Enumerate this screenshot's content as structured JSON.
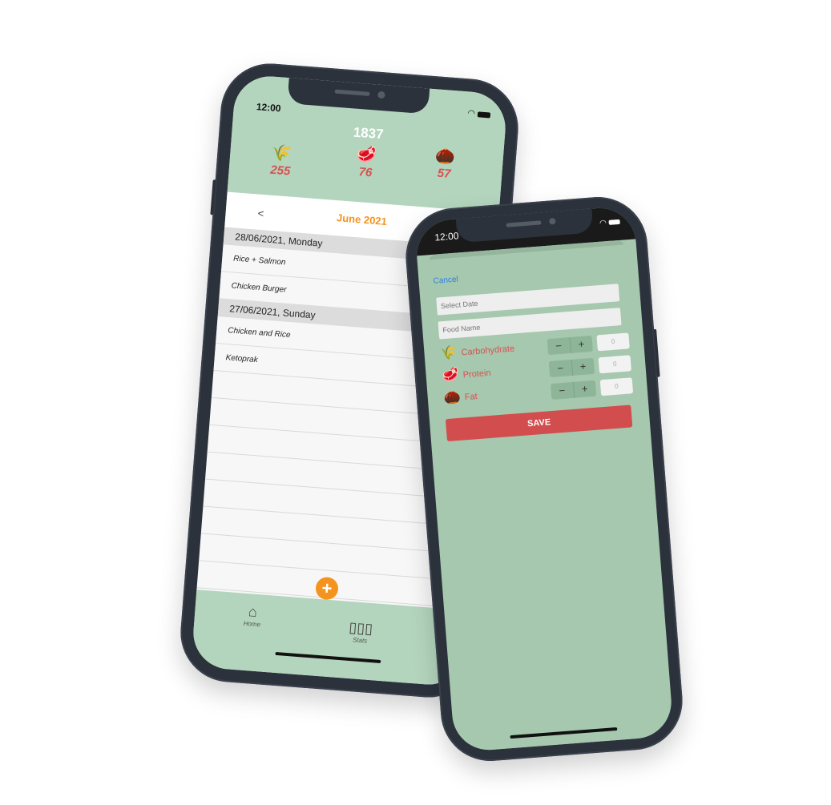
{
  "home_screen": {
    "status_time": "12:00",
    "total_calories": "1837",
    "macros": [
      {
        "icon": "wheat-icon",
        "value": "255"
      },
      {
        "icon": "meat-icon",
        "value": "76"
      },
      {
        "icon": "acorn-icon",
        "value": "57"
      }
    ],
    "nav": {
      "back_label": "<",
      "month_label": "June 2021"
    },
    "sections": [
      {
        "date": "28/06/2021, Monday",
        "items": [
          "Rice + Salmon",
          "Chicken Burger"
        ]
      },
      {
        "date": "27/06/2021, Sunday",
        "items": [
          "Chicken and Rice",
          "Ketoprak"
        ]
      }
    ],
    "fab_label": "+",
    "tabs": [
      {
        "icon": "home-icon",
        "label": "Home"
      },
      {
        "icon": "stats-icon",
        "label": "Stats"
      }
    ]
  },
  "add_screen": {
    "status_time": "12:00",
    "cancel_label": "Cancel",
    "date_placeholder": "Select Date",
    "food_placeholder": "Food Name",
    "macros": [
      {
        "icon": "wheat-icon",
        "label": "Carbohydrate",
        "value": "0"
      },
      {
        "icon": "meat-icon",
        "label": "Protein",
        "value": "0"
      },
      {
        "icon": "acorn-icon",
        "label": "Fat",
        "value": "0"
      }
    ],
    "stepper": {
      "minus": "−",
      "plus": "+"
    },
    "save_label": "SAVE"
  },
  "colors": {
    "header_green": "#b4d5bd",
    "sheet_green": "#a6c8ae",
    "accent_orange": "#f4931d",
    "macro_red": "#d65252",
    "save_red": "#d24e4e",
    "cancel_blue": "#2f7fe0"
  }
}
